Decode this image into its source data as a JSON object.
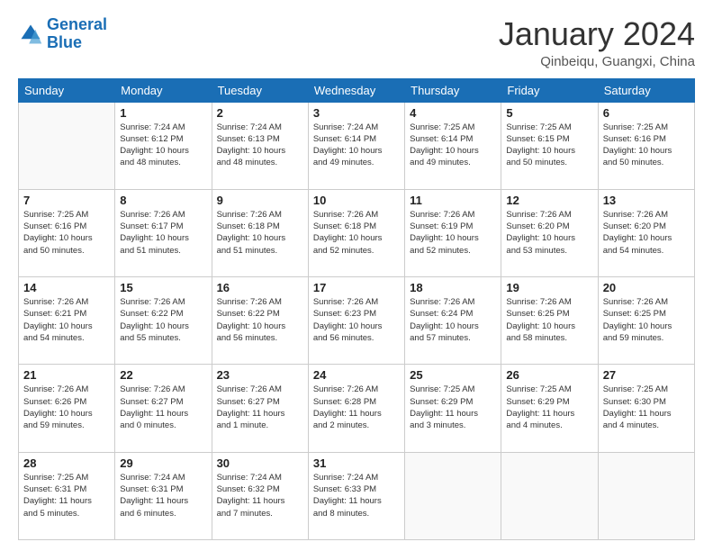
{
  "header": {
    "logo_line1": "General",
    "logo_line2": "Blue",
    "month_title": "January 2024",
    "location": "Qinbeiqu, Guangxi, China"
  },
  "days_of_week": [
    "Sunday",
    "Monday",
    "Tuesday",
    "Wednesday",
    "Thursday",
    "Friday",
    "Saturday"
  ],
  "weeks": [
    [
      {
        "day": "",
        "info": ""
      },
      {
        "day": "1",
        "info": "Sunrise: 7:24 AM\nSunset: 6:12 PM\nDaylight: 10 hours\nand 48 minutes."
      },
      {
        "day": "2",
        "info": "Sunrise: 7:24 AM\nSunset: 6:13 PM\nDaylight: 10 hours\nand 48 minutes."
      },
      {
        "day": "3",
        "info": "Sunrise: 7:24 AM\nSunset: 6:14 PM\nDaylight: 10 hours\nand 49 minutes."
      },
      {
        "day": "4",
        "info": "Sunrise: 7:25 AM\nSunset: 6:14 PM\nDaylight: 10 hours\nand 49 minutes."
      },
      {
        "day": "5",
        "info": "Sunrise: 7:25 AM\nSunset: 6:15 PM\nDaylight: 10 hours\nand 50 minutes."
      },
      {
        "day": "6",
        "info": "Sunrise: 7:25 AM\nSunset: 6:16 PM\nDaylight: 10 hours\nand 50 minutes."
      }
    ],
    [
      {
        "day": "7",
        "info": "Sunrise: 7:25 AM\nSunset: 6:16 PM\nDaylight: 10 hours\nand 50 minutes."
      },
      {
        "day": "8",
        "info": "Sunrise: 7:26 AM\nSunset: 6:17 PM\nDaylight: 10 hours\nand 51 minutes."
      },
      {
        "day": "9",
        "info": "Sunrise: 7:26 AM\nSunset: 6:18 PM\nDaylight: 10 hours\nand 51 minutes."
      },
      {
        "day": "10",
        "info": "Sunrise: 7:26 AM\nSunset: 6:18 PM\nDaylight: 10 hours\nand 52 minutes."
      },
      {
        "day": "11",
        "info": "Sunrise: 7:26 AM\nSunset: 6:19 PM\nDaylight: 10 hours\nand 52 minutes."
      },
      {
        "day": "12",
        "info": "Sunrise: 7:26 AM\nSunset: 6:20 PM\nDaylight: 10 hours\nand 53 minutes."
      },
      {
        "day": "13",
        "info": "Sunrise: 7:26 AM\nSunset: 6:20 PM\nDaylight: 10 hours\nand 54 minutes."
      }
    ],
    [
      {
        "day": "14",
        "info": "Sunrise: 7:26 AM\nSunset: 6:21 PM\nDaylight: 10 hours\nand 54 minutes."
      },
      {
        "day": "15",
        "info": "Sunrise: 7:26 AM\nSunset: 6:22 PM\nDaylight: 10 hours\nand 55 minutes."
      },
      {
        "day": "16",
        "info": "Sunrise: 7:26 AM\nSunset: 6:22 PM\nDaylight: 10 hours\nand 56 minutes."
      },
      {
        "day": "17",
        "info": "Sunrise: 7:26 AM\nSunset: 6:23 PM\nDaylight: 10 hours\nand 56 minutes."
      },
      {
        "day": "18",
        "info": "Sunrise: 7:26 AM\nSunset: 6:24 PM\nDaylight: 10 hours\nand 57 minutes."
      },
      {
        "day": "19",
        "info": "Sunrise: 7:26 AM\nSunset: 6:25 PM\nDaylight: 10 hours\nand 58 minutes."
      },
      {
        "day": "20",
        "info": "Sunrise: 7:26 AM\nSunset: 6:25 PM\nDaylight: 10 hours\nand 59 minutes."
      }
    ],
    [
      {
        "day": "21",
        "info": "Sunrise: 7:26 AM\nSunset: 6:26 PM\nDaylight: 10 hours\nand 59 minutes."
      },
      {
        "day": "22",
        "info": "Sunrise: 7:26 AM\nSunset: 6:27 PM\nDaylight: 11 hours\nand 0 minutes."
      },
      {
        "day": "23",
        "info": "Sunrise: 7:26 AM\nSunset: 6:27 PM\nDaylight: 11 hours\nand 1 minute."
      },
      {
        "day": "24",
        "info": "Sunrise: 7:26 AM\nSunset: 6:28 PM\nDaylight: 11 hours\nand 2 minutes."
      },
      {
        "day": "25",
        "info": "Sunrise: 7:25 AM\nSunset: 6:29 PM\nDaylight: 11 hours\nand 3 minutes."
      },
      {
        "day": "26",
        "info": "Sunrise: 7:25 AM\nSunset: 6:29 PM\nDaylight: 11 hours\nand 4 minutes."
      },
      {
        "day": "27",
        "info": "Sunrise: 7:25 AM\nSunset: 6:30 PM\nDaylight: 11 hours\nand 4 minutes."
      }
    ],
    [
      {
        "day": "28",
        "info": "Sunrise: 7:25 AM\nSunset: 6:31 PM\nDaylight: 11 hours\nand 5 minutes."
      },
      {
        "day": "29",
        "info": "Sunrise: 7:24 AM\nSunset: 6:31 PM\nDaylight: 11 hours\nand 6 minutes."
      },
      {
        "day": "30",
        "info": "Sunrise: 7:24 AM\nSunset: 6:32 PM\nDaylight: 11 hours\nand 7 minutes."
      },
      {
        "day": "31",
        "info": "Sunrise: 7:24 AM\nSunset: 6:33 PM\nDaylight: 11 hours\nand 8 minutes."
      },
      {
        "day": "",
        "info": ""
      },
      {
        "day": "",
        "info": ""
      },
      {
        "day": "",
        "info": ""
      }
    ]
  ]
}
